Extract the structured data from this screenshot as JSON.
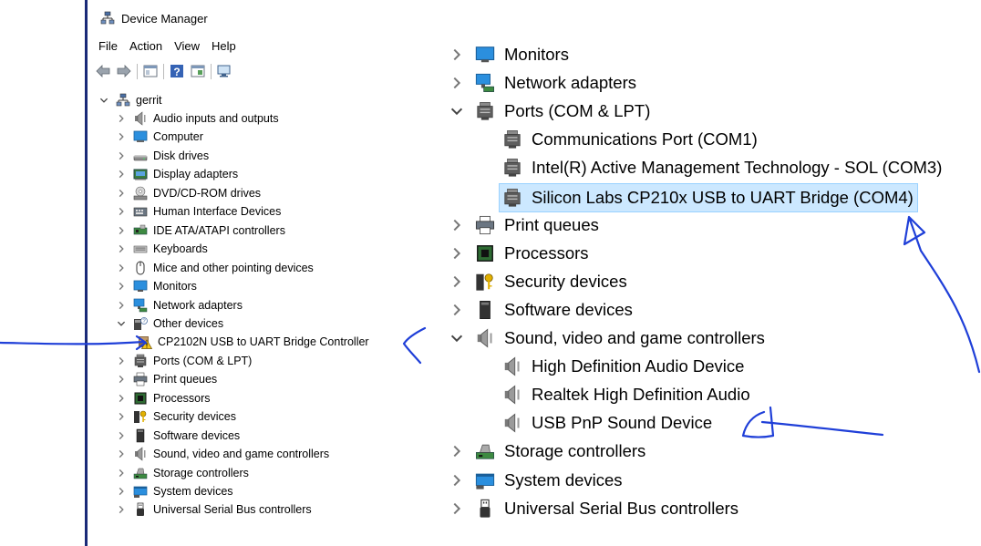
{
  "window": {
    "title": "Device Manager"
  },
  "menu": [
    "File",
    "Action",
    "View",
    "Help"
  ],
  "left_tree": {
    "root": "gerrit",
    "items": [
      {
        "label": "Audio inputs and outputs",
        "icon": "speaker-icon",
        "state": "collapsed"
      },
      {
        "label": "Computer",
        "icon": "computer-icon",
        "state": "collapsed"
      },
      {
        "label": "Disk drives",
        "icon": "disk-drive-icon",
        "state": "collapsed"
      },
      {
        "label": "Display adapters",
        "icon": "display-adapter-icon",
        "state": "collapsed"
      },
      {
        "label": "DVD/CD-ROM drives",
        "icon": "dvd-drive-icon",
        "state": "collapsed"
      },
      {
        "label": "Human Interface Devices",
        "icon": "hid-icon",
        "state": "collapsed"
      },
      {
        "label": "IDE ATA/ATAPI controllers",
        "icon": "ide-controller-icon",
        "state": "collapsed"
      },
      {
        "label": "Keyboards",
        "icon": "keyboard-icon",
        "state": "collapsed"
      },
      {
        "label": "Mice and other pointing devices",
        "icon": "mouse-icon",
        "state": "collapsed"
      },
      {
        "label": "Monitors",
        "icon": "monitor-icon",
        "state": "collapsed"
      },
      {
        "label": "Network adapters",
        "icon": "network-adapter-icon",
        "state": "collapsed"
      },
      {
        "label": "Other devices",
        "icon": "other-devices-icon",
        "state": "expanded"
      },
      {
        "label": "CP2102N USB to UART Bridge Controller",
        "icon": "warning-device-icon",
        "state": "child"
      },
      {
        "label": "Ports (COM & LPT)",
        "icon": "port-icon",
        "state": "collapsed"
      },
      {
        "label": "Print queues",
        "icon": "printer-icon",
        "state": "collapsed"
      },
      {
        "label": "Processors",
        "icon": "processor-icon",
        "state": "collapsed"
      },
      {
        "label": "Security devices",
        "icon": "security-device-icon",
        "state": "collapsed"
      },
      {
        "label": "Software devices",
        "icon": "software-device-icon",
        "state": "collapsed"
      },
      {
        "label": "Sound, video and game controllers",
        "icon": "speaker-icon",
        "state": "collapsed"
      },
      {
        "label": "Storage controllers",
        "icon": "storage-controller-icon",
        "state": "collapsed"
      },
      {
        "label": "System devices",
        "icon": "system-device-icon",
        "state": "collapsed"
      },
      {
        "label": "Universal Serial Bus controllers",
        "icon": "usb-icon",
        "state": "collapsed"
      }
    ]
  },
  "right_tree": {
    "items": [
      {
        "label": "Monitors",
        "icon": "monitor-icon",
        "state": "collapsed"
      },
      {
        "label": "Network adapters",
        "icon": "network-adapter-icon",
        "state": "collapsed"
      },
      {
        "label": "Ports (COM & LPT)",
        "icon": "port-icon",
        "state": "expanded"
      },
      {
        "label": "Communications Port (COM1)",
        "icon": "port-icon",
        "state": "child"
      },
      {
        "label": "Intel(R) Active Management Technology - SOL (COM3)",
        "icon": "port-icon",
        "state": "child"
      },
      {
        "label": "Silicon Labs CP210x USB to UART Bridge (COM4)",
        "icon": "port-icon",
        "state": "child-selected"
      },
      {
        "label": "Print queues",
        "icon": "printer-icon",
        "state": "collapsed"
      },
      {
        "label": "Processors",
        "icon": "processor-icon",
        "state": "collapsed"
      },
      {
        "label": "Security devices",
        "icon": "security-device-icon",
        "state": "collapsed"
      },
      {
        "label": "Software devices",
        "icon": "software-device-icon",
        "state": "collapsed"
      },
      {
        "label": "Sound, video and game controllers",
        "icon": "speaker-icon",
        "state": "expanded"
      },
      {
        "label": "High Definition Audio Device",
        "icon": "speaker-icon",
        "state": "child"
      },
      {
        "label": "Realtek High Definition Audio",
        "icon": "speaker-icon",
        "state": "child"
      },
      {
        "label": "USB PnP Sound Device",
        "icon": "speaker-icon",
        "state": "child"
      },
      {
        "label": "Storage controllers",
        "icon": "storage-controller-icon",
        "state": "collapsed"
      },
      {
        "label": "System devices",
        "icon": "system-device-icon",
        "state": "collapsed"
      },
      {
        "label": "Universal Serial Bus controllers",
        "icon": "usb-icon",
        "state": "collapsed"
      }
    ]
  },
  "colors": {
    "selection": "#cce8ff",
    "annotation": "#1f3fd8",
    "warning": "#f5c518"
  }
}
